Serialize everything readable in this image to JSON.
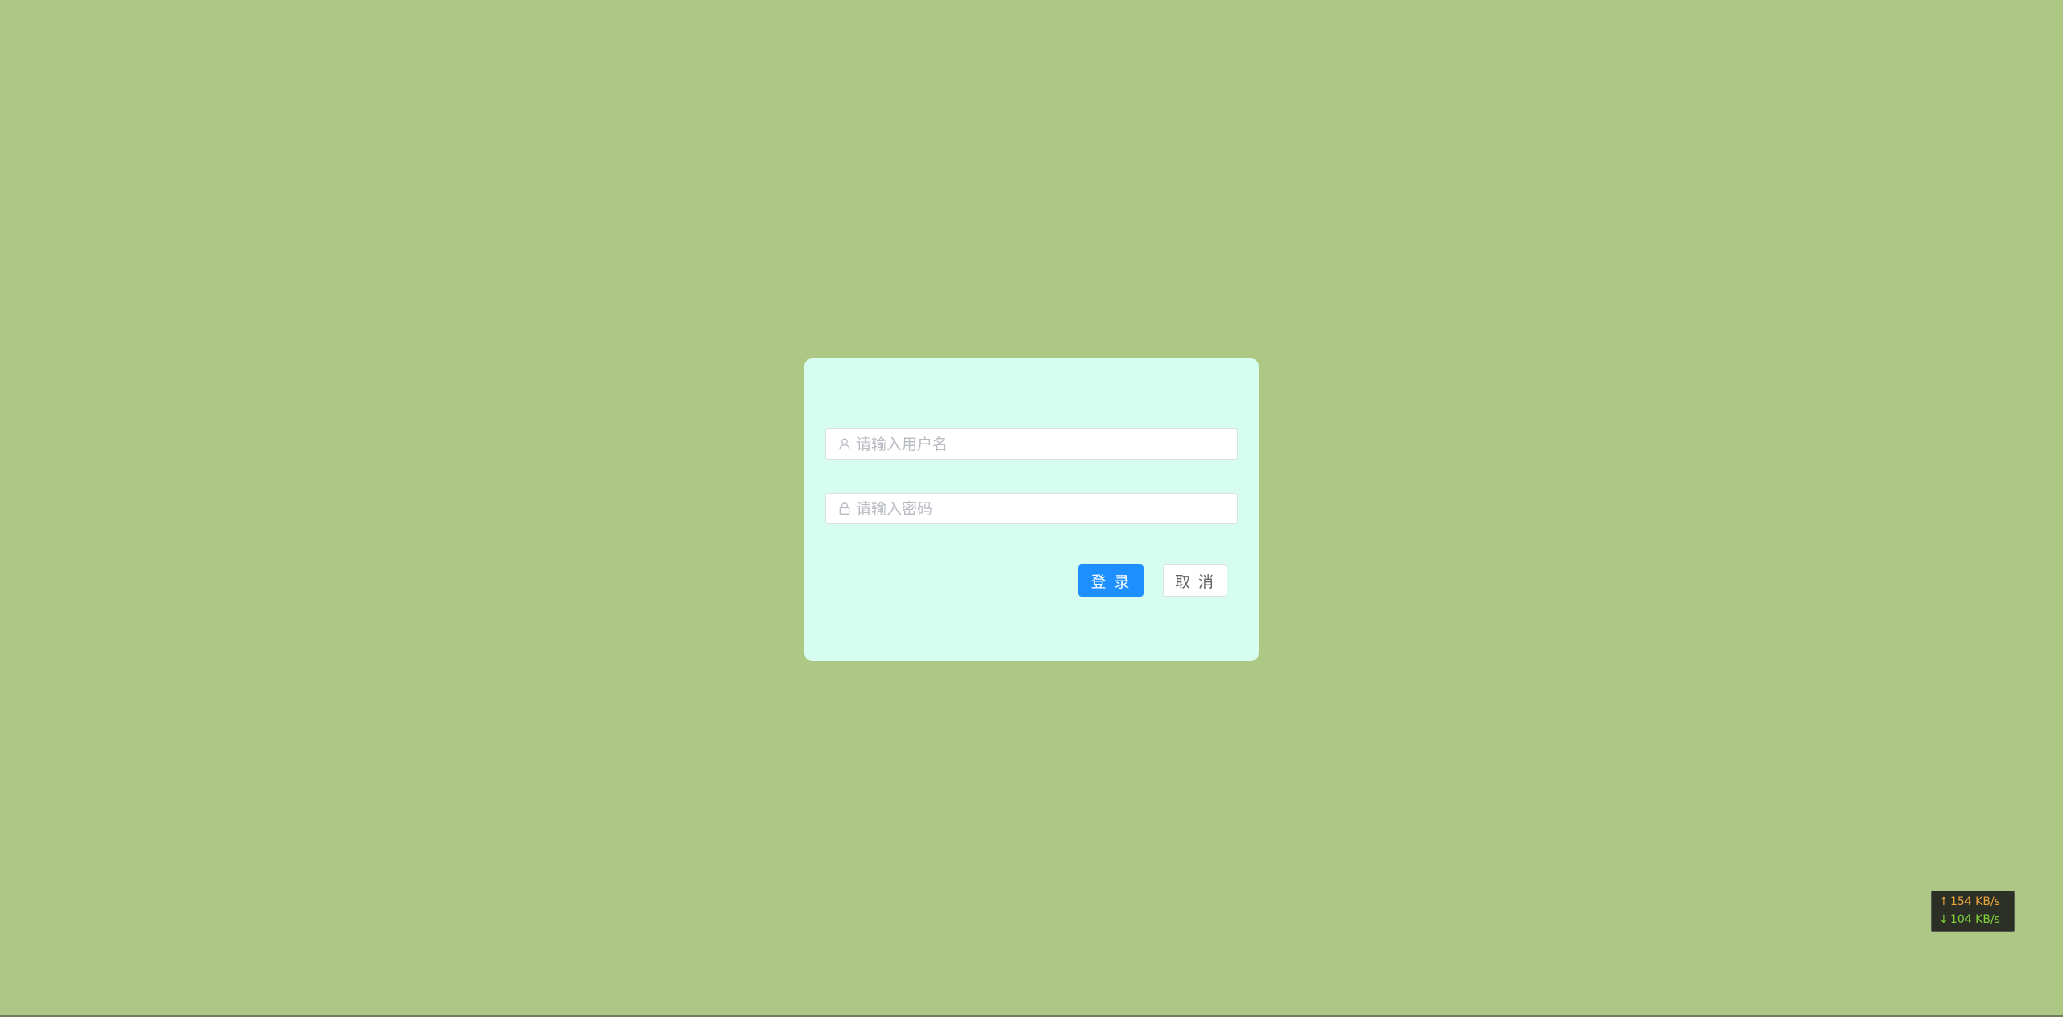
{
  "login_form": {
    "username": {
      "placeholder": "请输入用户名",
      "value": "",
      "icon": "user-icon"
    },
    "password": {
      "placeholder": "请输入密码",
      "value": "",
      "icon": "lock-icon"
    },
    "login_label": "登 录",
    "cancel_label": "取 消"
  },
  "netspeed": {
    "up_arrow": "↑",
    "up": "154 KB/s",
    "down_arrow": "↓",
    "down": "104 KB/s"
  },
  "colors": {
    "background": "#adc884",
    "card": "#d6fdf0",
    "primary": "#1e8fff",
    "upload": "#e7a33c",
    "download": "#7fd13b"
  }
}
